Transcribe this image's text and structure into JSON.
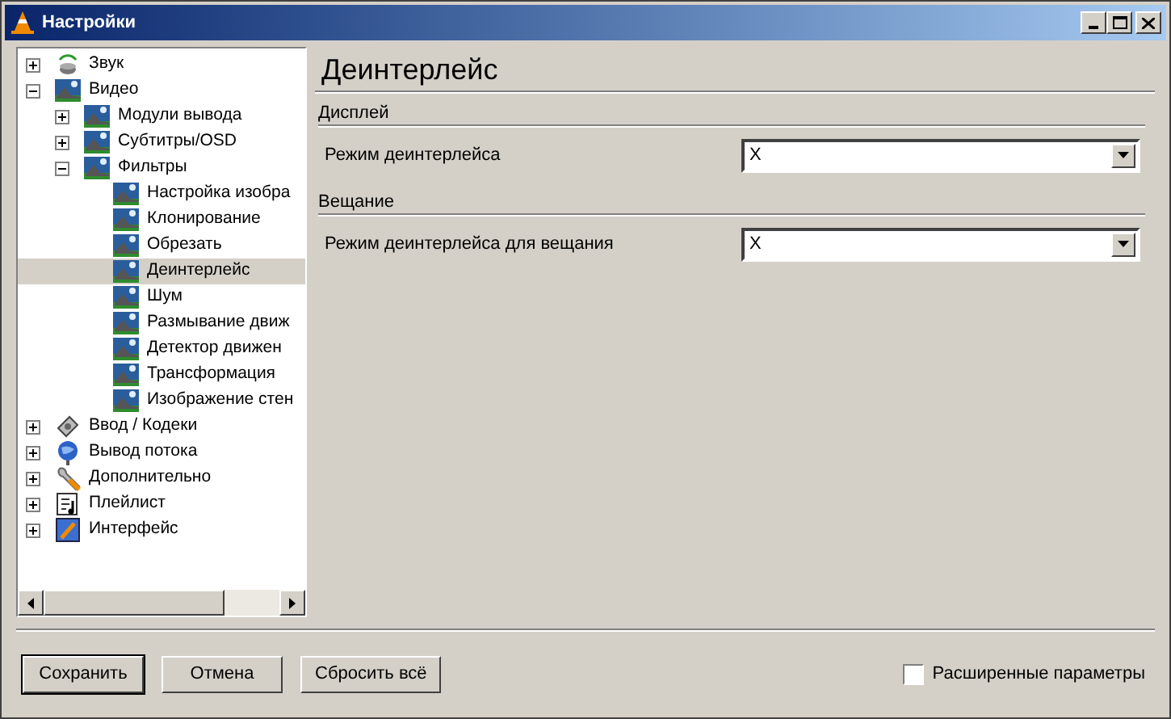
{
  "window": {
    "title": "Настройки"
  },
  "tree": [
    {
      "label": "Звук",
      "expanded": false,
      "selected": false
    },
    {
      "label": "Видео",
      "expanded": true,
      "selected": false,
      "children": [
        {
          "label": "Модули вывода",
          "expanded": false,
          "selected": false
        },
        {
          "label": "Субтитры/OSD",
          "expanded": false,
          "selected": false
        },
        {
          "label": "Фильтры",
          "expanded": true,
          "selected": false,
          "children": [
            {
              "label": "Настройка изобра",
              "selected": false
            },
            {
              "label": "Клонирование",
              "selected": false
            },
            {
              "label": "Обрезать",
              "selected": false
            },
            {
              "label": "Деинтерлейс",
              "selected": true
            },
            {
              "label": "Шум",
              "selected": false
            },
            {
              "label": "Размывание движ",
              "selected": false
            },
            {
              "label": "Детектор движен",
              "selected": false
            },
            {
              "label": "Трансформация",
              "selected": false
            },
            {
              "label": "Изображение стен",
              "selected": false
            }
          ]
        }
      ]
    },
    {
      "label": "Ввод / Кодеки",
      "expanded": false,
      "selected": false
    },
    {
      "label": "Вывод потока",
      "expanded": false,
      "selected": false
    },
    {
      "label": "Дополнительно",
      "expanded": false,
      "selected": false
    },
    {
      "label": "Плейлист",
      "expanded": false,
      "selected": false
    },
    {
      "label": "Интерфейс",
      "expanded": false,
      "selected": false
    }
  ],
  "panel": {
    "title": "Деинтерлейс",
    "sections": [
      {
        "title": "Дисплей",
        "label": "Режим деинтерлейса",
        "value": "X"
      },
      {
        "title": "Вещание",
        "label": "Режим деинтерлейса для вещания",
        "value": "X"
      }
    ]
  },
  "buttons": [
    {
      "label": "Сохранить",
      "default": true
    },
    {
      "label": "Отмена",
      "default": false
    },
    {
      "label": "Сбросить всё",
      "default": false
    }
  ],
  "advanced": {
    "label": "Расширенные параметры",
    "checked": false
  }
}
